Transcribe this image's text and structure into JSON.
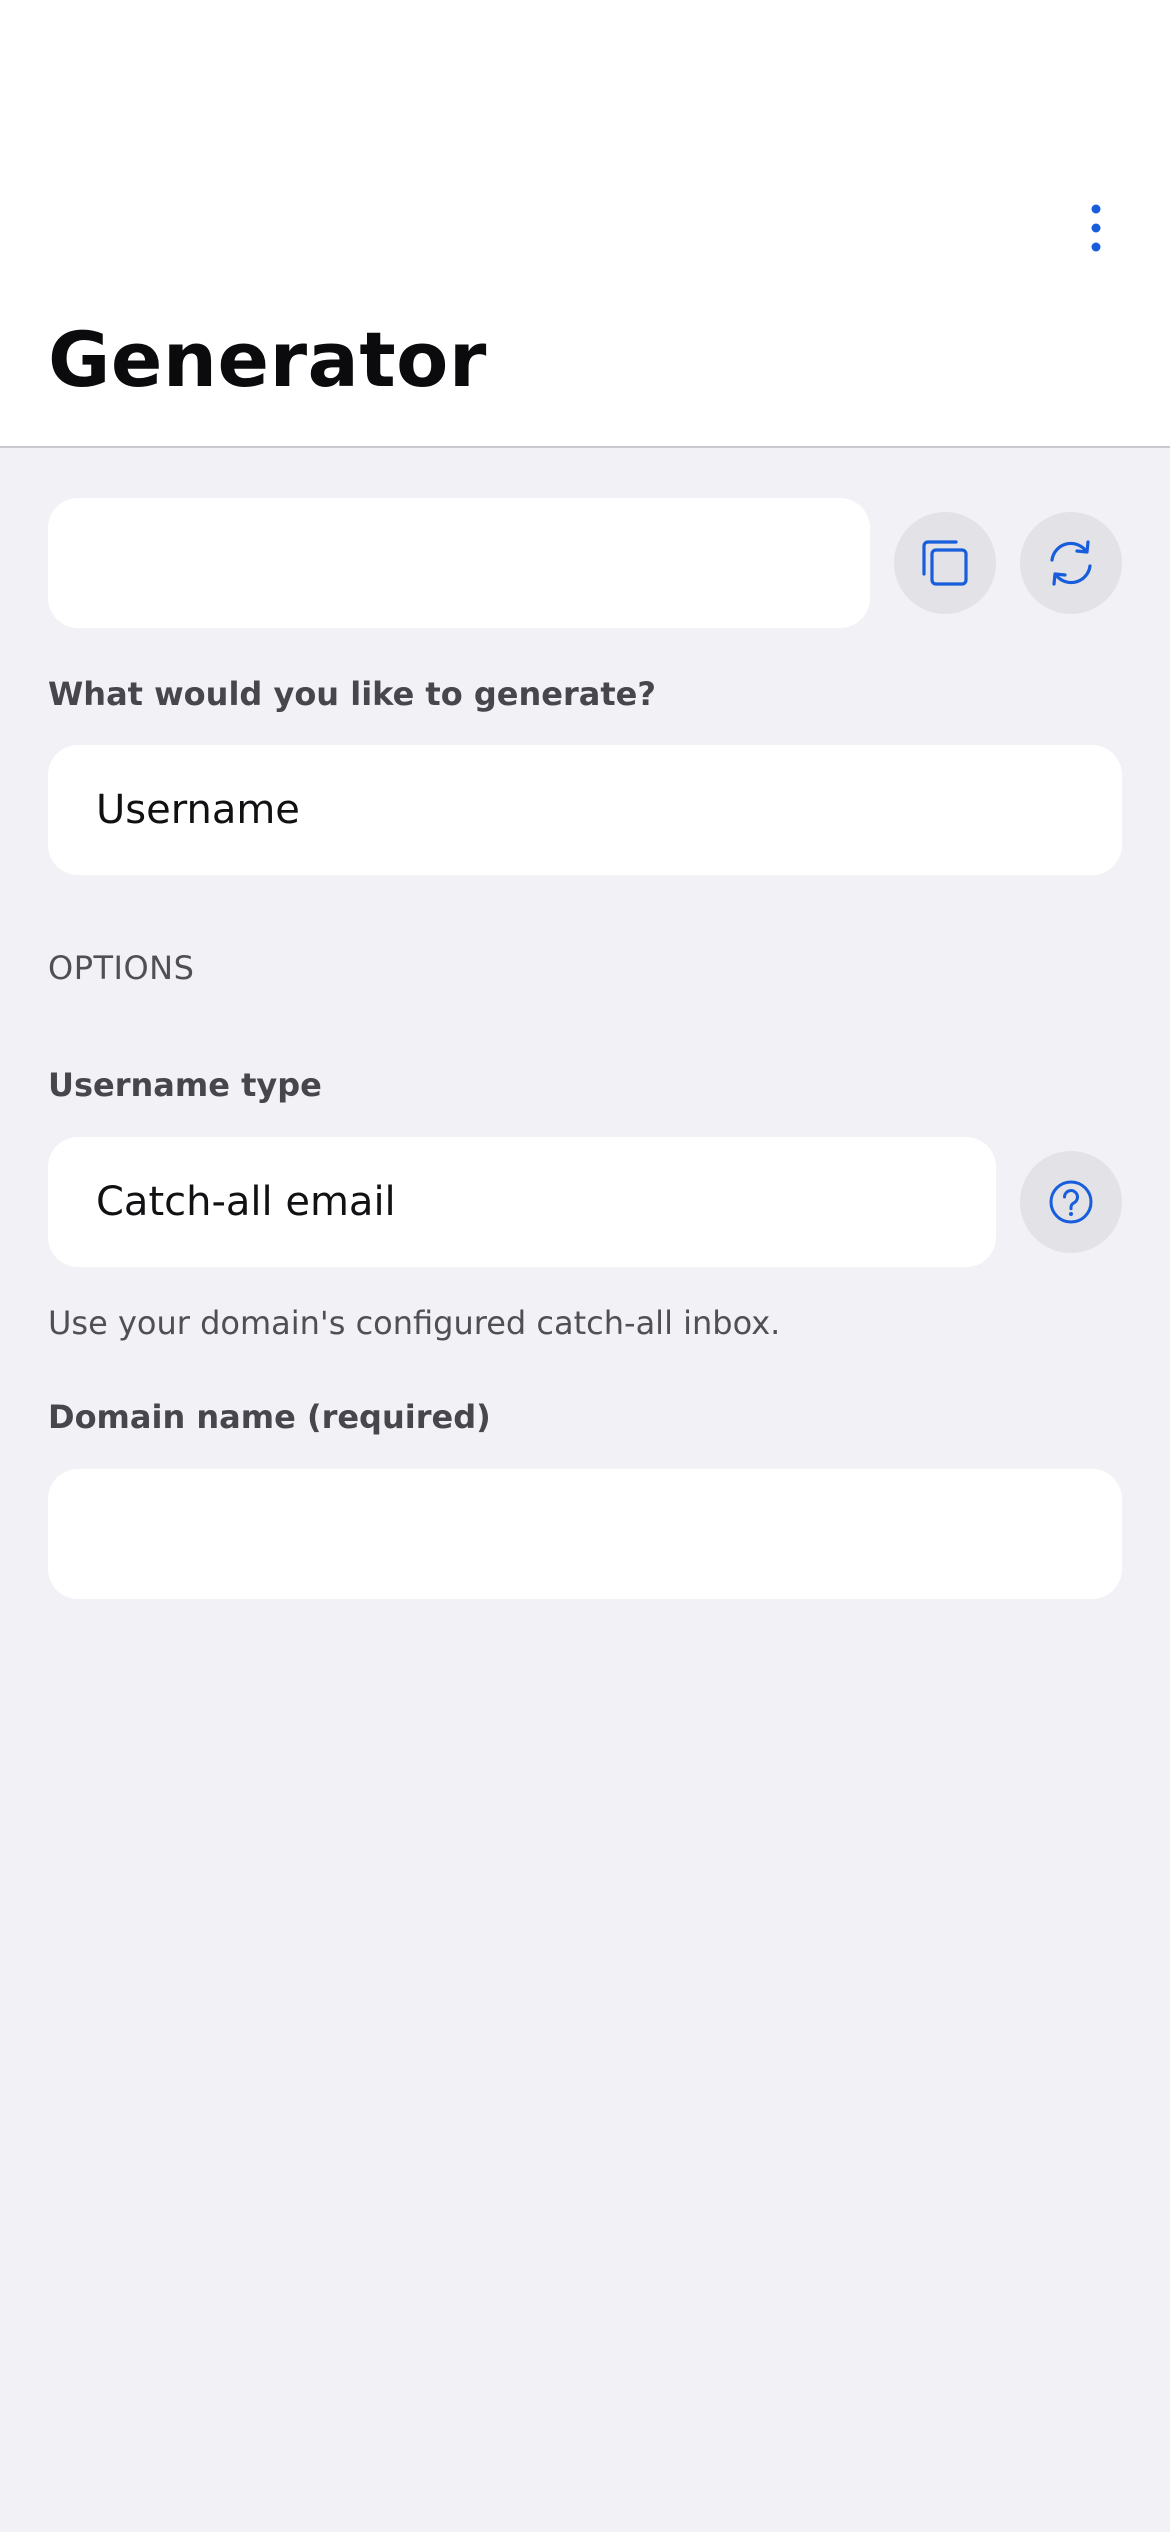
{
  "header": {
    "title": "Generator",
    "menu_icon": "more-vertical-icon"
  },
  "generated_value": {
    "value": "",
    "copy_icon": "copy-icon",
    "regenerate_icon": "refresh-icon"
  },
  "generate_type": {
    "label": "What would you like to generate?",
    "value": "Username"
  },
  "options": {
    "header": "OPTIONS",
    "username_type": {
      "label": "Username type",
      "value": "Catch-all email",
      "help_icon": "help-circle-icon",
      "description": "Use your domain's configured catch-all inbox."
    },
    "domain_name": {
      "label": "Domain name (required)",
      "value": ""
    }
  },
  "colors": {
    "accent": "#175ddc",
    "background": "#f1f1f6",
    "surface": "#ffffff",
    "icon_button": "#e2e2e7"
  }
}
